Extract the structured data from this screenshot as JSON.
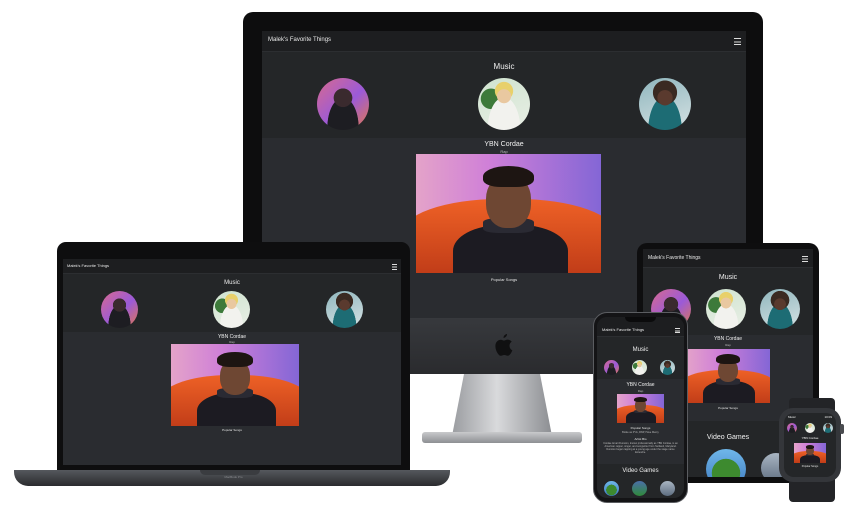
{
  "site": {
    "title": "Malek's Favorite Things",
    "section_music": "Music",
    "section_games": "Video Games",
    "artist_name": "YBN Cordae",
    "artist_genre": "Rap",
    "popular_songs_label": "Popular Songs",
    "popular_songs_text": "Broke as F*ck, RNP, Have Mercy",
    "artist_bio_label": "Artist Bio",
    "artist_bio_text": "Cordae Amari Dunston, known professionally as YBN Cordae, is an American rapper, singer, and songwriter from Suitland, Maryland. Dunston began rapping at a young age under the stage name Entendre."
  },
  "devices": {
    "laptop_brand": "MacBook Pro",
    "watch_clock": "10:09"
  },
  "colors": {
    "page_background": "#242628",
    "topbar": "#1d1e20",
    "text": "#f0f0f0"
  },
  "icons": [
    "menu-icon",
    "apple-logo-icon"
  ]
}
